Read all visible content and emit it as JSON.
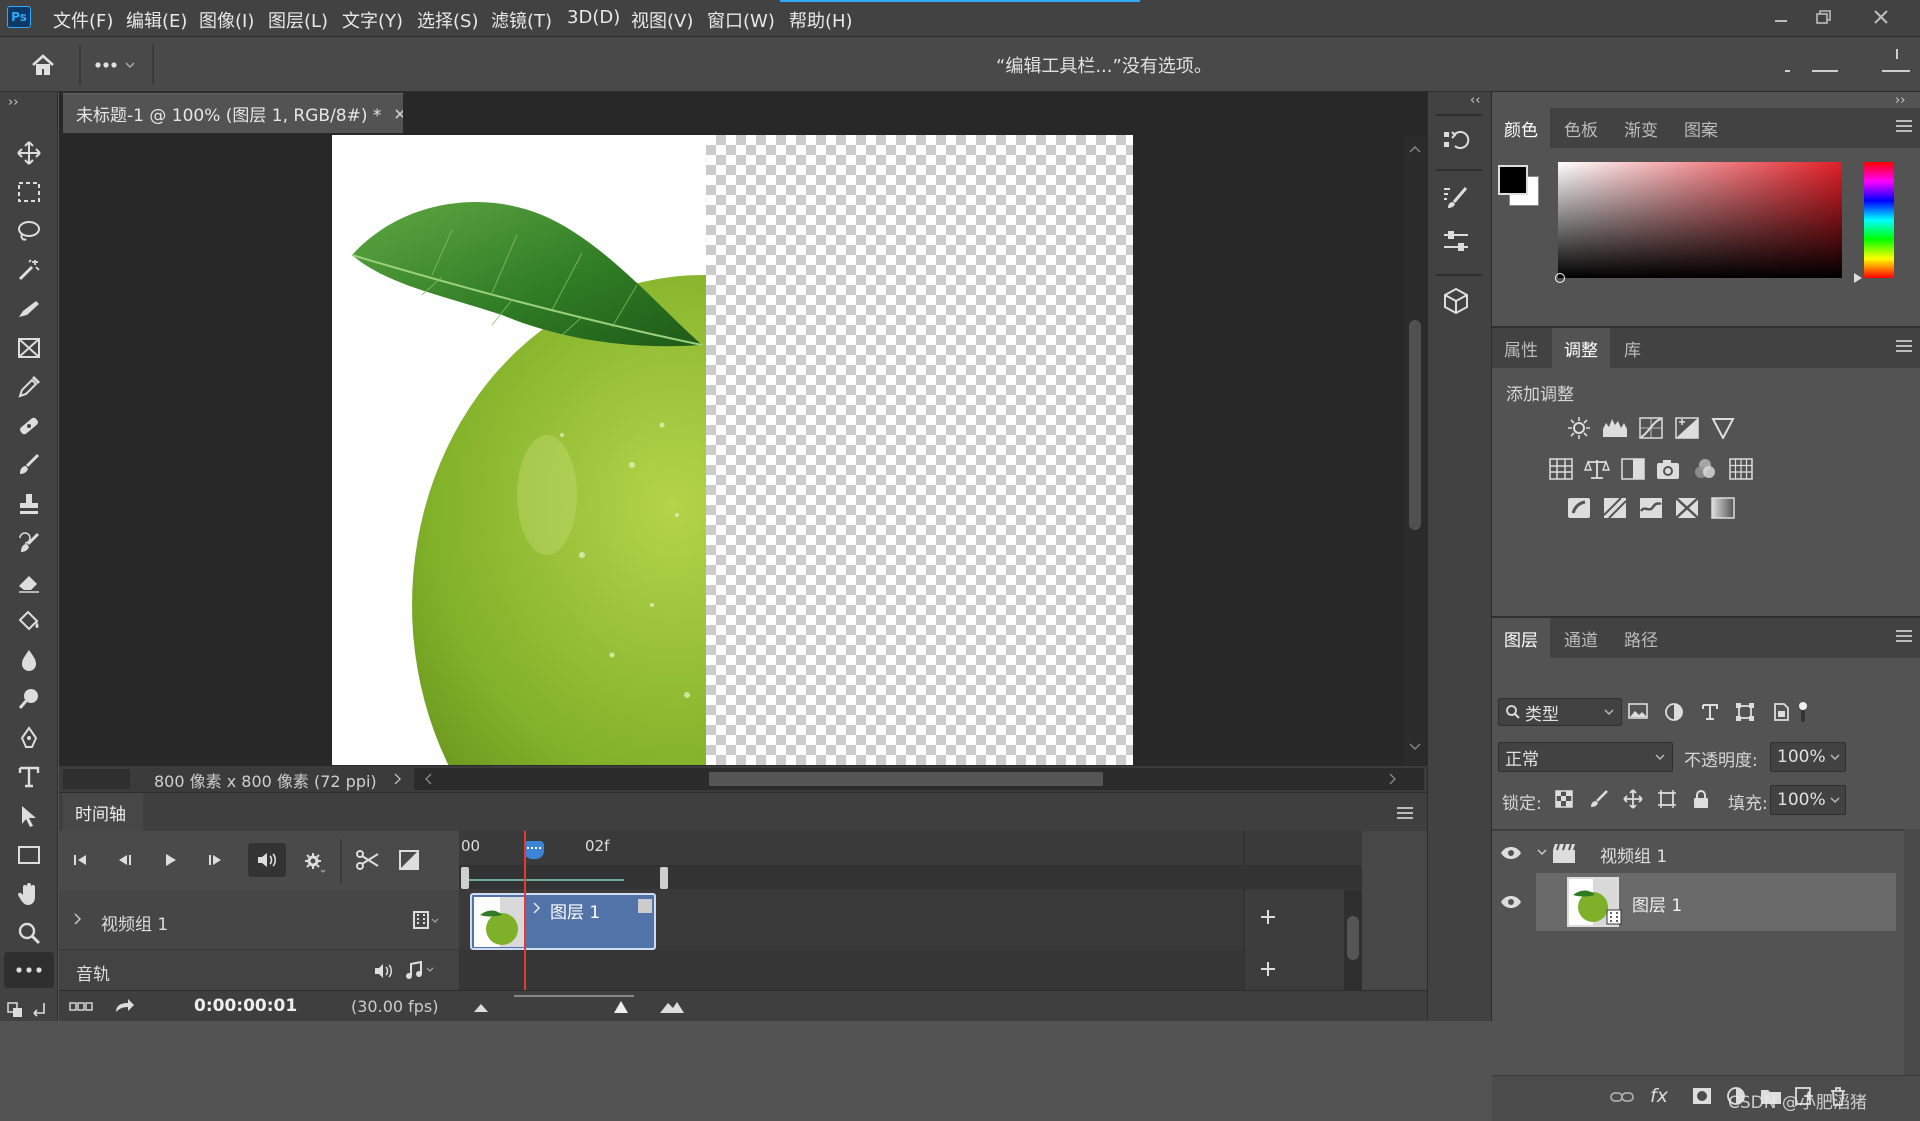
{
  "app": {
    "logo": "Ps",
    "accent": "#31a8ff"
  },
  "menu": [
    "文件(F)",
    "编辑(E)",
    "图像(I)",
    "图层(L)",
    "文字(Y)",
    "选择(S)",
    "滤镜(T)",
    "3D(D)",
    "视图(V)",
    "窗口(W)",
    "帮助(H)"
  ],
  "options_bar": {
    "message": "“编辑工具栏...”没有选项。"
  },
  "document": {
    "tab_title": "未标题-1 @ 100% (图层 1, RGB/8#) *",
    "status": "800 像素 x 800 像素 (72 ppi)"
  },
  "timeline": {
    "title": "时间轴",
    "ruler_labels": [
      "00",
      "02f"
    ],
    "video_group": "视频组 1",
    "clip_label": "图层 1",
    "audio_track": "音轨",
    "timecode": "0:00:00:01",
    "fps": "(30.00 fps)"
  },
  "color_panel": {
    "tabs": [
      "颜色",
      "色板",
      "渐变",
      "图案"
    ],
    "active_tab": "颜色",
    "foreground": "#000000",
    "background": "#ffffff"
  },
  "adjustments_panel": {
    "tabs": [
      "属性",
      "调整",
      "库"
    ],
    "active_tab": "调整",
    "heading": "添加调整"
  },
  "layers_panel": {
    "tabs": [
      "图层",
      "通道",
      "路径"
    ],
    "active_tab": "图层",
    "filter_kind": "类型",
    "blend_mode": "正常",
    "opacity_label": "不透明度:",
    "opacity": "100%",
    "lock_label": "锁定:",
    "fill_label": "填充:",
    "fill": "100%",
    "layers": [
      {
        "name": "视频组 1",
        "type": "group"
      },
      {
        "name": "图层 1",
        "type": "video-layer",
        "selected": true
      }
    ],
    "watermark": "CSDN @小肥滔猪"
  }
}
